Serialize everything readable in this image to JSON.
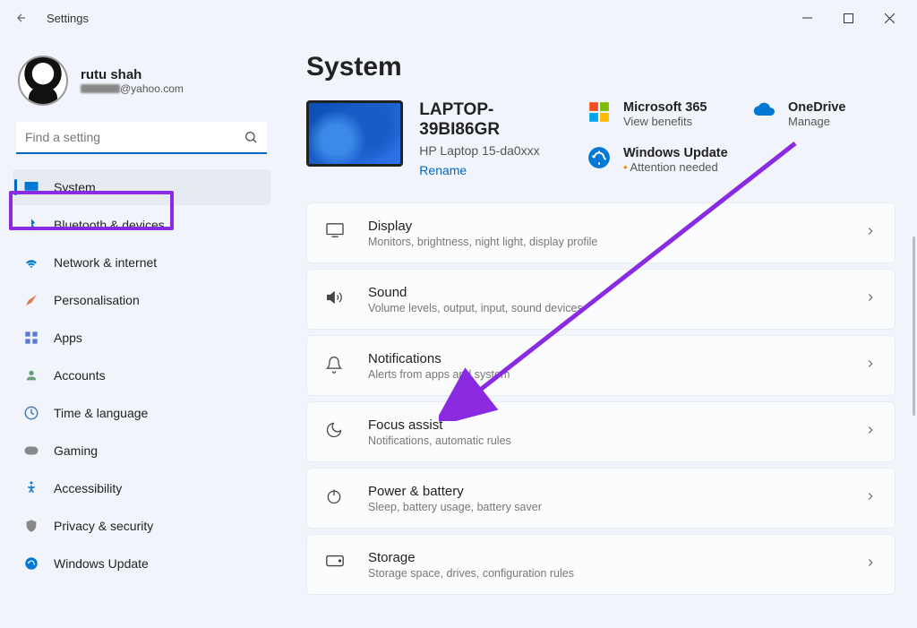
{
  "window": {
    "title": "Settings"
  },
  "profile": {
    "name": "rutu shah",
    "email_suffix": "@yahoo.com"
  },
  "search": {
    "placeholder": "Find a setting"
  },
  "nav": [
    {
      "id": "system",
      "label": "System",
      "active": true
    },
    {
      "id": "bluetooth",
      "label": "Bluetooth & devices",
      "active": false
    },
    {
      "id": "network",
      "label": "Network & internet",
      "active": false
    },
    {
      "id": "personalisation",
      "label": "Personalisation",
      "active": false
    },
    {
      "id": "apps",
      "label": "Apps",
      "active": false
    },
    {
      "id": "accounts",
      "label": "Accounts",
      "active": false
    },
    {
      "id": "time",
      "label": "Time & language",
      "active": false
    },
    {
      "id": "gaming",
      "label": "Gaming",
      "active": false
    },
    {
      "id": "accessibility",
      "label": "Accessibility",
      "active": false
    },
    {
      "id": "privacy",
      "label": "Privacy & security",
      "active": false
    },
    {
      "id": "update",
      "label": "Windows Update",
      "active": false
    }
  ],
  "page": {
    "title": "System"
  },
  "device": {
    "name": "LAPTOP-39BI86GR",
    "model": "HP Laptop 15-da0xxx",
    "rename": "Rename"
  },
  "info": {
    "ms365": {
      "title": "Microsoft 365",
      "sub": "View benefits"
    },
    "onedrive": {
      "title": "OneDrive",
      "sub": "Manage"
    },
    "update": {
      "title": "Windows Update",
      "sub": "Attention needed"
    }
  },
  "settings": [
    {
      "id": "display",
      "title": "Display",
      "sub": "Monitors, brightness, night light, display profile"
    },
    {
      "id": "sound",
      "title": "Sound",
      "sub": "Volume levels, output, input, sound devices"
    },
    {
      "id": "notifications",
      "title": "Notifications",
      "sub": "Alerts from apps and system"
    },
    {
      "id": "focus",
      "title": "Focus assist",
      "sub": "Notifications, automatic rules"
    },
    {
      "id": "power",
      "title": "Power & battery",
      "sub": "Sleep, battery usage, battery saver"
    },
    {
      "id": "storage",
      "title": "Storage",
      "sub": "Storage space, drives, configuration rules"
    }
  ]
}
